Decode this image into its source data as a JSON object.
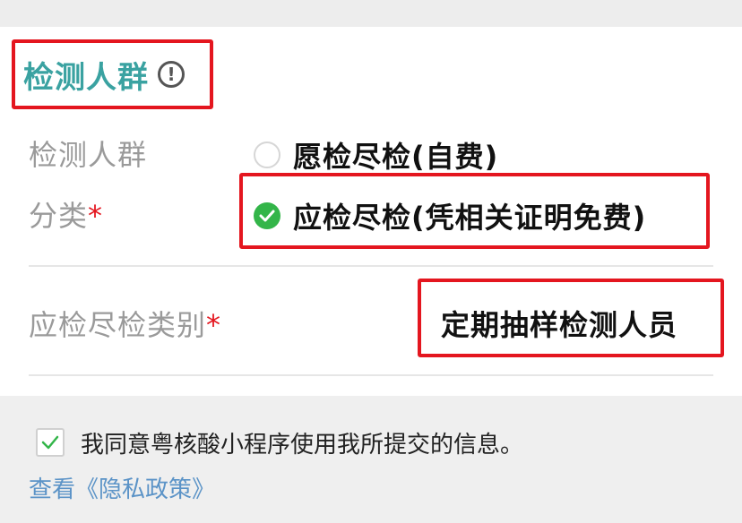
{
  "section": {
    "title": "检测人群",
    "icon": "info-icon"
  },
  "group_field": {
    "label_line1": "检测人群",
    "label_line2": "分类",
    "required_mark": "*",
    "options": [
      {
        "label": "愿检尽检(自费)",
        "selected": false
      },
      {
        "label": "应检尽检(凭相关证明免费)",
        "selected": true
      }
    ]
  },
  "category_field": {
    "label": "应检尽检类别",
    "required_mark": "*",
    "value": "定期抽样检测人员"
  },
  "consent": {
    "checked": true,
    "text": "我同意粤核酸小程序使用我所提交的信息。",
    "privacy_link": "查看《隐私政策》"
  },
  "colors": {
    "accent_teal": "#3aa2a1",
    "highlight_red": "#e4161f",
    "selected_green": "#33b549",
    "link_blue": "#5b93c7"
  }
}
